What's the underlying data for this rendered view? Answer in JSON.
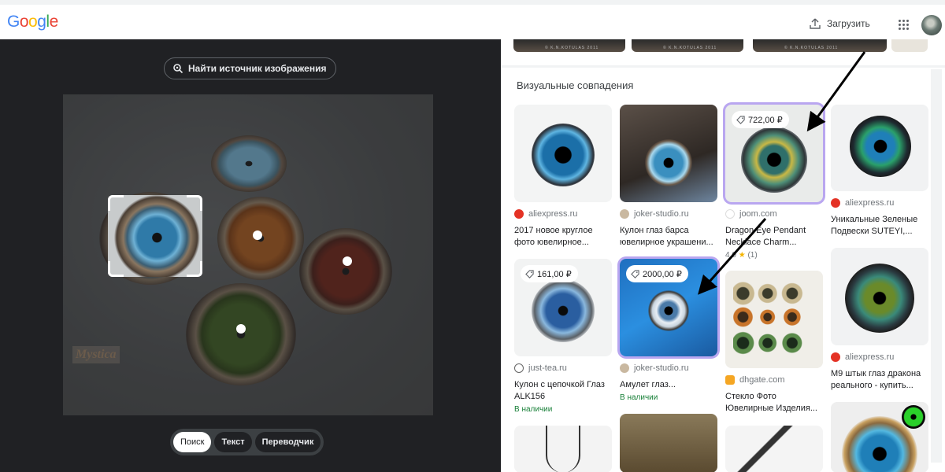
{
  "header": {
    "logo": [
      "G",
      "o",
      "o",
      "g",
      "l",
      "e"
    ],
    "logo_colors": [
      "#4285f4",
      "#ea4335",
      "#fbbc05",
      "#4285f4",
      "#34a853",
      "#ea4335"
    ],
    "upload_label": "Загрузить",
    "upload_icon": "upload-icon",
    "apps_icon": "apps-grid-icon",
    "avatar_icon": "user-avatar"
  },
  "left": {
    "find_source_label": "Найти источник изображения",
    "find_source_icon": "lens-search-icon",
    "watermark": "Mystica",
    "tabs": [
      {
        "label": "Поиск",
        "active": true
      },
      {
        "label": "Текст",
        "active": false
      },
      {
        "label": "Переводчик",
        "active": false
      }
    ]
  },
  "right": {
    "section_title": "Визуальные совпадения",
    "highlight_color": "#b9a6f0",
    "cards": [
      {
        "source": "aliexpress.ru",
        "title": "2017 новое круглое фото ювелирное...",
        "price": "",
        "stock": "",
        "rating": ""
      },
      {
        "source": "joker-studio.ru",
        "title": "Кулон глаз барса ювелирное украшени...",
        "price": "",
        "stock": "",
        "rating": ""
      },
      {
        "source": "joom.com",
        "title": "Dragon Eye Pendant Necklace Charm...",
        "price": "722,00 ₽",
        "stock": "",
        "rating": "4.0",
        "rating_count": "(1)"
      },
      {
        "source": "aliexpress.ru",
        "title": "Уникальные Зеленые Подвески SUTEYI,...",
        "price": "",
        "stock": "",
        "rating": ""
      },
      {
        "source": "just-tea.ru",
        "title": "Кулон с цепочкой Глаз ALK156",
        "price": "161,00 ₽",
        "stock": "В наличии",
        "rating": ""
      },
      {
        "source": "joker-studio.ru",
        "title": "Амулет глаз...",
        "price": "2000,00 ₽",
        "stock": "В наличии",
        "rating": ""
      },
      {
        "source": "dhgate.com",
        "title": "Стекло Фото Ювелирные Изделия...",
        "price": "",
        "stock": "",
        "rating": ""
      },
      {
        "source": "aliexpress.ru",
        "title": "M9 штык глаз дракона реального - купить...",
        "price": "",
        "stock": "",
        "rating": ""
      }
    ]
  }
}
